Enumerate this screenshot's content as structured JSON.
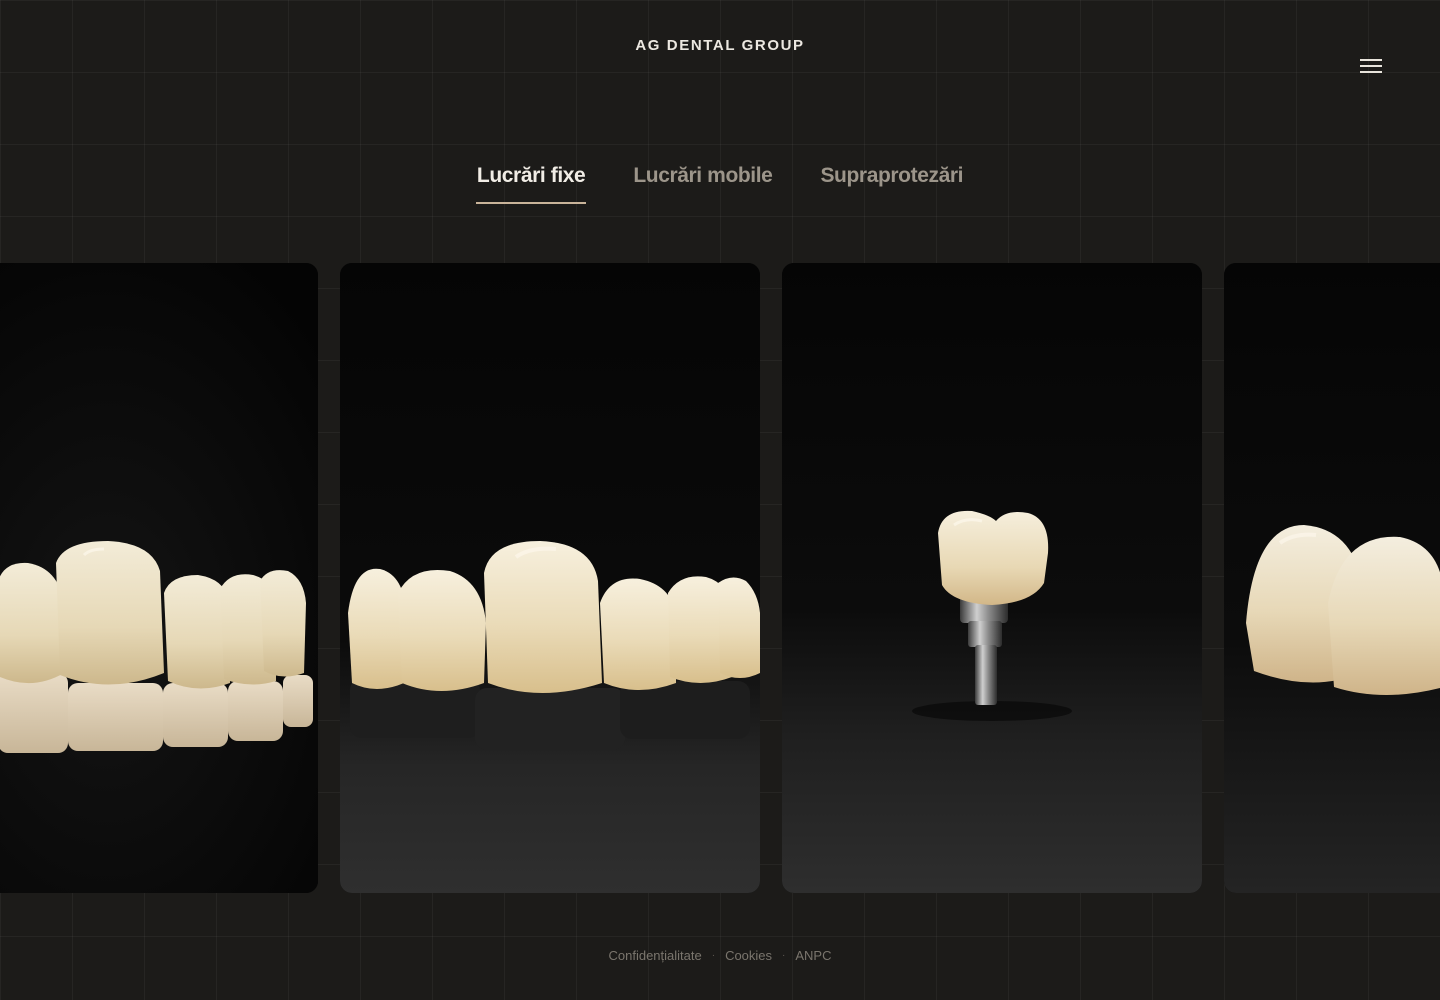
{
  "header": {
    "brand": "AG DENTAL GROUP",
    "menu_icon": "hamburger-menu-icon"
  },
  "tabs": [
    {
      "label": "Lucrări fixe",
      "active": true
    },
    {
      "label": "Lucrări mobile",
      "active": false
    },
    {
      "label": "Supraprotezări",
      "active": false
    }
  ],
  "gallery": {
    "items": [
      {
        "kind": "crowns-on-ivory-dies"
      },
      {
        "kind": "crowns-on-black-bases"
      },
      {
        "kind": "crown-on-implant-abutment"
      },
      {
        "kind": "crowns-closeup"
      }
    ]
  },
  "footer": {
    "links": [
      "Confidențialitate",
      "Cookies",
      "ANPC"
    ],
    "separator": "·"
  },
  "colors": {
    "background": "#1c1b19",
    "accent_underline": "#c9b49a",
    "text_primary": "#f1ede6",
    "text_muted": "#9c958a"
  }
}
